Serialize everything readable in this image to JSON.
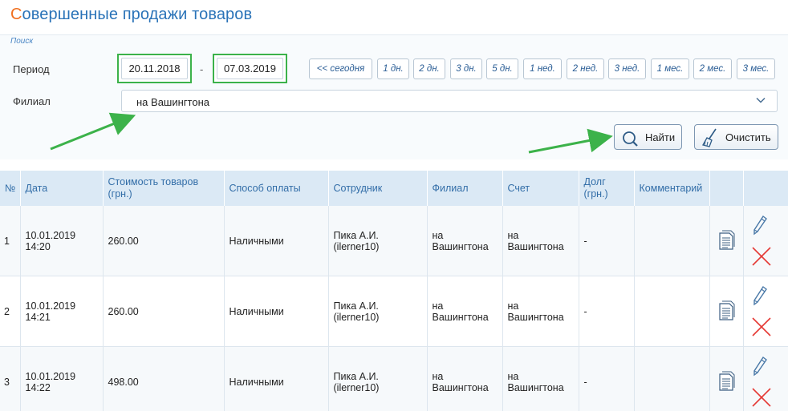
{
  "page": {
    "title_first_letter": "С",
    "title_rest": "овершенные продажи товаров",
    "search_label": "Поиск"
  },
  "filters": {
    "period_label": "Период",
    "date_from": "20.11.2018",
    "date_separator": "-",
    "date_to": "07.03.2019",
    "quick_ranges": [
      "<< сегодня",
      "1 дн.",
      "2 дн.",
      "3 дн.",
      "5 дн.",
      "1 нед.",
      "2 нед.",
      "3 нед.",
      "1 мес.",
      "2 мес.",
      "3 мес."
    ],
    "branch_label": "Филиал",
    "branch_value": "на Вашингтона",
    "find_label": "Найти",
    "clear_label": "Очистить"
  },
  "table": {
    "headers": [
      "№",
      "Дата",
      "Стоимость товаров (грн.)",
      "Способ оплаты",
      "Сотрудник",
      "Филиал",
      "Счет",
      "Долг (грн.)",
      "Комментарий",
      "",
      ""
    ],
    "rows": [
      {
        "n": "1",
        "date": "10.01.2019",
        "time": "14:20",
        "cost": "260.00",
        "payment": "Наличными",
        "employee": "Пика А.И.",
        "login": "(ilerner10)",
        "branch_1": "на",
        "branch_2": "Вашингтона",
        "account_1": "на",
        "account_2": "Вашингтона",
        "debt": "-",
        "comment": ""
      },
      {
        "n": "2",
        "date": "10.01.2019",
        "time": "14:21",
        "cost": "260.00",
        "payment": "Наличными",
        "employee": "Пика А.И.",
        "login": "(ilerner10)",
        "branch_1": "на",
        "branch_2": "Вашингтона",
        "account_1": "на",
        "account_2": "Вашингтона",
        "debt": "-",
        "comment": ""
      },
      {
        "n": "3",
        "date": "10.01.2019",
        "time": "14:22",
        "cost": "498.00",
        "payment": "Наличными",
        "employee": "Пика А.И.",
        "login": "(ilerner10)",
        "branch_1": "на",
        "branch_2": "Вашингтона",
        "account_1": "на",
        "account_2": "Вашингтона",
        "debt": "-",
        "comment": ""
      }
    ]
  },
  "icons": {
    "search": "search-icon",
    "broom": "broom-icon",
    "document": "document-icon",
    "edit": "pencil-icon",
    "delete": "delete-cross-icon",
    "chevron": "chevron-down-icon"
  },
  "colors": {
    "title": "#2a73b8",
    "title_accent": "#f07020",
    "highlight": "#3cb24a",
    "header_bg": "#dbe9f5",
    "delete": "#e53935"
  }
}
